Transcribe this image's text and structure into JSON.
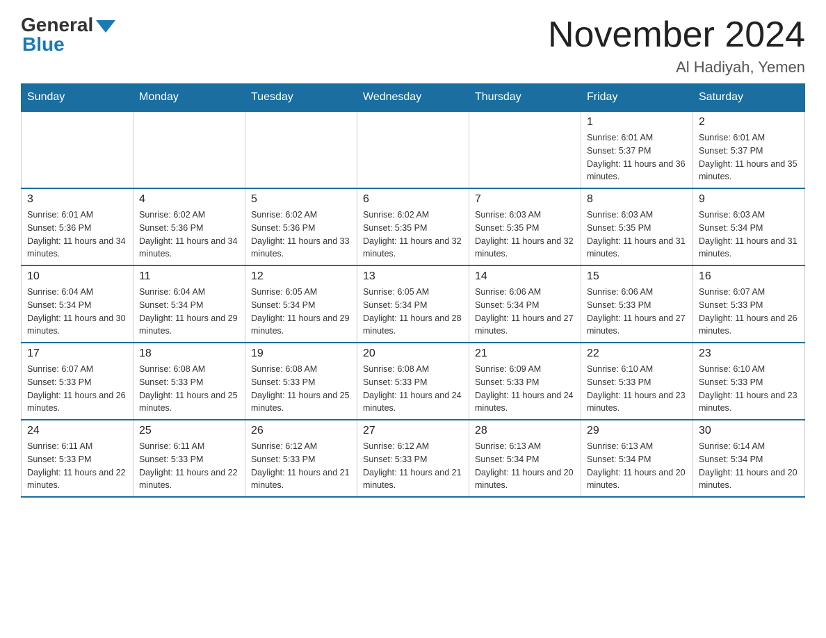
{
  "header": {
    "logo_general": "General",
    "logo_blue": "Blue",
    "main_title": "November 2024",
    "subtitle": "Al Hadiyah, Yemen"
  },
  "days_of_week": [
    "Sunday",
    "Monday",
    "Tuesday",
    "Wednesday",
    "Thursday",
    "Friday",
    "Saturday"
  ],
  "weeks": [
    [
      {
        "day": "",
        "info": ""
      },
      {
        "day": "",
        "info": ""
      },
      {
        "day": "",
        "info": ""
      },
      {
        "day": "",
        "info": ""
      },
      {
        "day": "",
        "info": ""
      },
      {
        "day": "1",
        "info": "Sunrise: 6:01 AM\nSunset: 5:37 PM\nDaylight: 11 hours and 36 minutes."
      },
      {
        "day": "2",
        "info": "Sunrise: 6:01 AM\nSunset: 5:37 PM\nDaylight: 11 hours and 35 minutes."
      }
    ],
    [
      {
        "day": "3",
        "info": "Sunrise: 6:01 AM\nSunset: 5:36 PM\nDaylight: 11 hours and 34 minutes."
      },
      {
        "day": "4",
        "info": "Sunrise: 6:02 AM\nSunset: 5:36 PM\nDaylight: 11 hours and 34 minutes."
      },
      {
        "day": "5",
        "info": "Sunrise: 6:02 AM\nSunset: 5:36 PM\nDaylight: 11 hours and 33 minutes."
      },
      {
        "day": "6",
        "info": "Sunrise: 6:02 AM\nSunset: 5:35 PM\nDaylight: 11 hours and 32 minutes."
      },
      {
        "day": "7",
        "info": "Sunrise: 6:03 AM\nSunset: 5:35 PM\nDaylight: 11 hours and 32 minutes."
      },
      {
        "day": "8",
        "info": "Sunrise: 6:03 AM\nSunset: 5:35 PM\nDaylight: 11 hours and 31 minutes."
      },
      {
        "day": "9",
        "info": "Sunrise: 6:03 AM\nSunset: 5:34 PM\nDaylight: 11 hours and 31 minutes."
      }
    ],
    [
      {
        "day": "10",
        "info": "Sunrise: 6:04 AM\nSunset: 5:34 PM\nDaylight: 11 hours and 30 minutes."
      },
      {
        "day": "11",
        "info": "Sunrise: 6:04 AM\nSunset: 5:34 PM\nDaylight: 11 hours and 29 minutes."
      },
      {
        "day": "12",
        "info": "Sunrise: 6:05 AM\nSunset: 5:34 PM\nDaylight: 11 hours and 29 minutes."
      },
      {
        "day": "13",
        "info": "Sunrise: 6:05 AM\nSunset: 5:34 PM\nDaylight: 11 hours and 28 minutes."
      },
      {
        "day": "14",
        "info": "Sunrise: 6:06 AM\nSunset: 5:34 PM\nDaylight: 11 hours and 27 minutes."
      },
      {
        "day": "15",
        "info": "Sunrise: 6:06 AM\nSunset: 5:33 PM\nDaylight: 11 hours and 27 minutes."
      },
      {
        "day": "16",
        "info": "Sunrise: 6:07 AM\nSunset: 5:33 PM\nDaylight: 11 hours and 26 minutes."
      }
    ],
    [
      {
        "day": "17",
        "info": "Sunrise: 6:07 AM\nSunset: 5:33 PM\nDaylight: 11 hours and 26 minutes."
      },
      {
        "day": "18",
        "info": "Sunrise: 6:08 AM\nSunset: 5:33 PM\nDaylight: 11 hours and 25 minutes."
      },
      {
        "day": "19",
        "info": "Sunrise: 6:08 AM\nSunset: 5:33 PM\nDaylight: 11 hours and 25 minutes."
      },
      {
        "day": "20",
        "info": "Sunrise: 6:08 AM\nSunset: 5:33 PM\nDaylight: 11 hours and 24 minutes."
      },
      {
        "day": "21",
        "info": "Sunrise: 6:09 AM\nSunset: 5:33 PM\nDaylight: 11 hours and 24 minutes."
      },
      {
        "day": "22",
        "info": "Sunrise: 6:10 AM\nSunset: 5:33 PM\nDaylight: 11 hours and 23 minutes."
      },
      {
        "day": "23",
        "info": "Sunrise: 6:10 AM\nSunset: 5:33 PM\nDaylight: 11 hours and 23 minutes."
      }
    ],
    [
      {
        "day": "24",
        "info": "Sunrise: 6:11 AM\nSunset: 5:33 PM\nDaylight: 11 hours and 22 minutes."
      },
      {
        "day": "25",
        "info": "Sunrise: 6:11 AM\nSunset: 5:33 PM\nDaylight: 11 hours and 22 minutes."
      },
      {
        "day": "26",
        "info": "Sunrise: 6:12 AM\nSunset: 5:33 PM\nDaylight: 11 hours and 21 minutes."
      },
      {
        "day": "27",
        "info": "Sunrise: 6:12 AM\nSunset: 5:33 PM\nDaylight: 11 hours and 21 minutes."
      },
      {
        "day": "28",
        "info": "Sunrise: 6:13 AM\nSunset: 5:34 PM\nDaylight: 11 hours and 20 minutes."
      },
      {
        "day": "29",
        "info": "Sunrise: 6:13 AM\nSunset: 5:34 PM\nDaylight: 11 hours and 20 minutes."
      },
      {
        "day": "30",
        "info": "Sunrise: 6:14 AM\nSunset: 5:34 PM\nDaylight: 11 hours and 20 minutes."
      }
    ]
  ]
}
